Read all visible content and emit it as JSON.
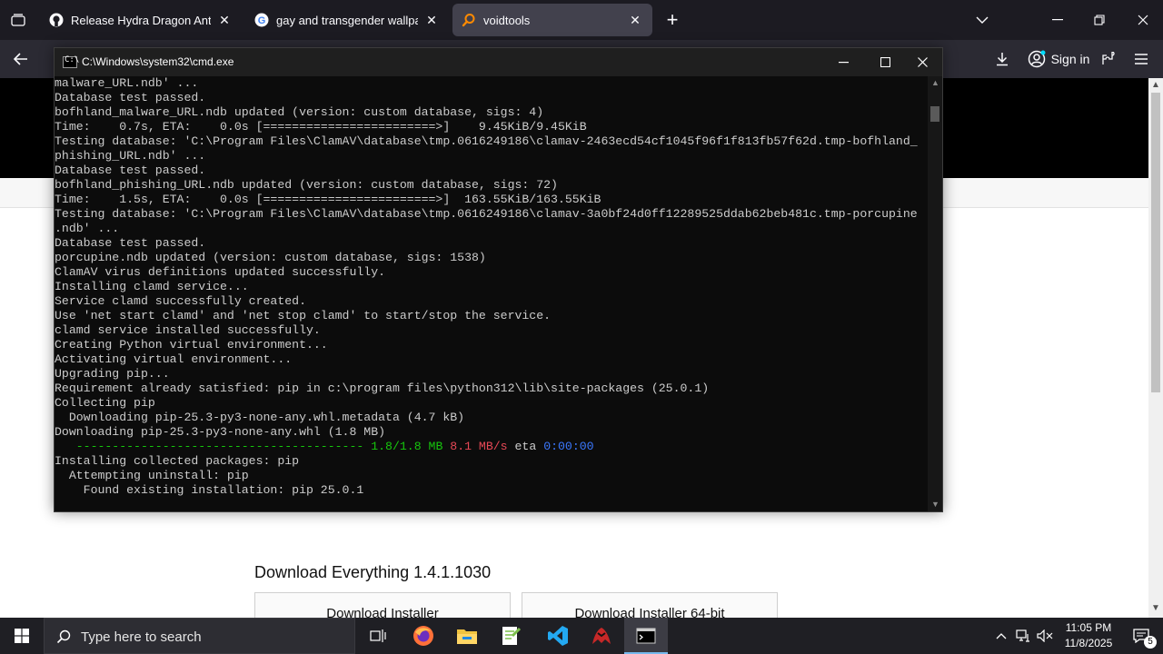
{
  "browser": {
    "tabs": [
      {
        "title": "Release Hydra Dragon Antivirus",
        "icon": "github-icon",
        "active": false
      },
      {
        "title": "gay and transgender wallpaper",
        "icon": "google-icon",
        "active": false
      },
      {
        "title": "voidtools",
        "icon": "search-icon",
        "active": true
      }
    ],
    "sign_in": "Sign in"
  },
  "cmd": {
    "title": "C:\\Windows\\system32\\cmd.exe",
    "lines": [
      {
        "text": "malware_URL.ndb' ..."
      },
      {
        "text": "Database test passed."
      },
      {
        "text": "bofhland_malware_URL.ndb updated (version: custom database, sigs: 4)"
      },
      {
        "text": "Time:    0.7s, ETA:    0.0s [========================>]    9.45KiB/9.45KiB"
      },
      {
        "text": "Testing database: 'C:\\Program Files\\ClamAV\\database\\tmp.0616249186\\clamav-2463ecd54cf1045f96f1f813fb57f62d.tmp-bofhland_"
      },
      {
        "text": "phishing_URL.ndb' ..."
      },
      {
        "text": "Database test passed."
      },
      {
        "text": "bofhland_phishing_URL.ndb updated (version: custom database, sigs: 72)"
      },
      {
        "text": "Time:    1.5s, ETA:    0.0s [========================>]  163.55KiB/163.55KiB"
      },
      {
        "text": "Testing database: 'C:\\Program Files\\ClamAV\\database\\tmp.0616249186\\clamav-3a0bf24d0ff12289525ddab62beb481c.tmp-porcupine"
      },
      {
        "text": ".ndb' ..."
      },
      {
        "text": "Database test passed."
      },
      {
        "text": "porcupine.ndb updated (version: custom database, sigs: 1538)"
      },
      {
        "text": "ClamAV virus definitions updated successfully."
      },
      {
        "text": "Installing clamd service..."
      },
      {
        "text": "Service clamd successfully created."
      },
      {
        "text": "Use 'net start clamd' and 'net stop clamd' to start/stop the service."
      },
      {
        "text": "clamd service installed successfully."
      },
      {
        "text": "Creating Python virtual environment..."
      },
      {
        "text": "Activating virtual environment..."
      },
      {
        "text": "Upgrading pip..."
      },
      {
        "text": "Requirement already satisfied: pip in c:\\program files\\python312\\lib\\site-packages (25.0.1)"
      },
      {
        "text": "Collecting pip"
      },
      {
        "text": "  Downloading pip-25.3-py3-none-any.whl.metadata (4.7 kB)"
      },
      {
        "text": "Downloading pip-25.3-py3-none-any.whl (1.8 MB)"
      },
      {
        "text": "__progress__"
      },
      {
        "text": "Installing collected packages: pip"
      },
      {
        "text": "  Attempting uninstall: pip"
      },
      {
        "text": "    Found existing installation: pip 25.0.1"
      }
    ],
    "progress": {
      "bar": "   ----------------------------------------",
      "size": "1.8/1.8 MB",
      "speed": "8.1 MB/s",
      "eta_label": "eta",
      "eta": "0:00:00"
    }
  },
  "page": {
    "download_heading": "Download Everything 1.4.1.1030",
    "btn_installer": "Download Installer",
    "btn_installer64": "Download Installer 64-bit"
  },
  "taskbar": {
    "search_placeholder": "Type here to search",
    "time": "11:05 PM",
    "date": "11/8/2025",
    "notification_count": "5"
  },
  "colors": {
    "progress_green": "#16c60c",
    "progress_red": "#e74856",
    "progress_blue": "#3b78ff"
  }
}
